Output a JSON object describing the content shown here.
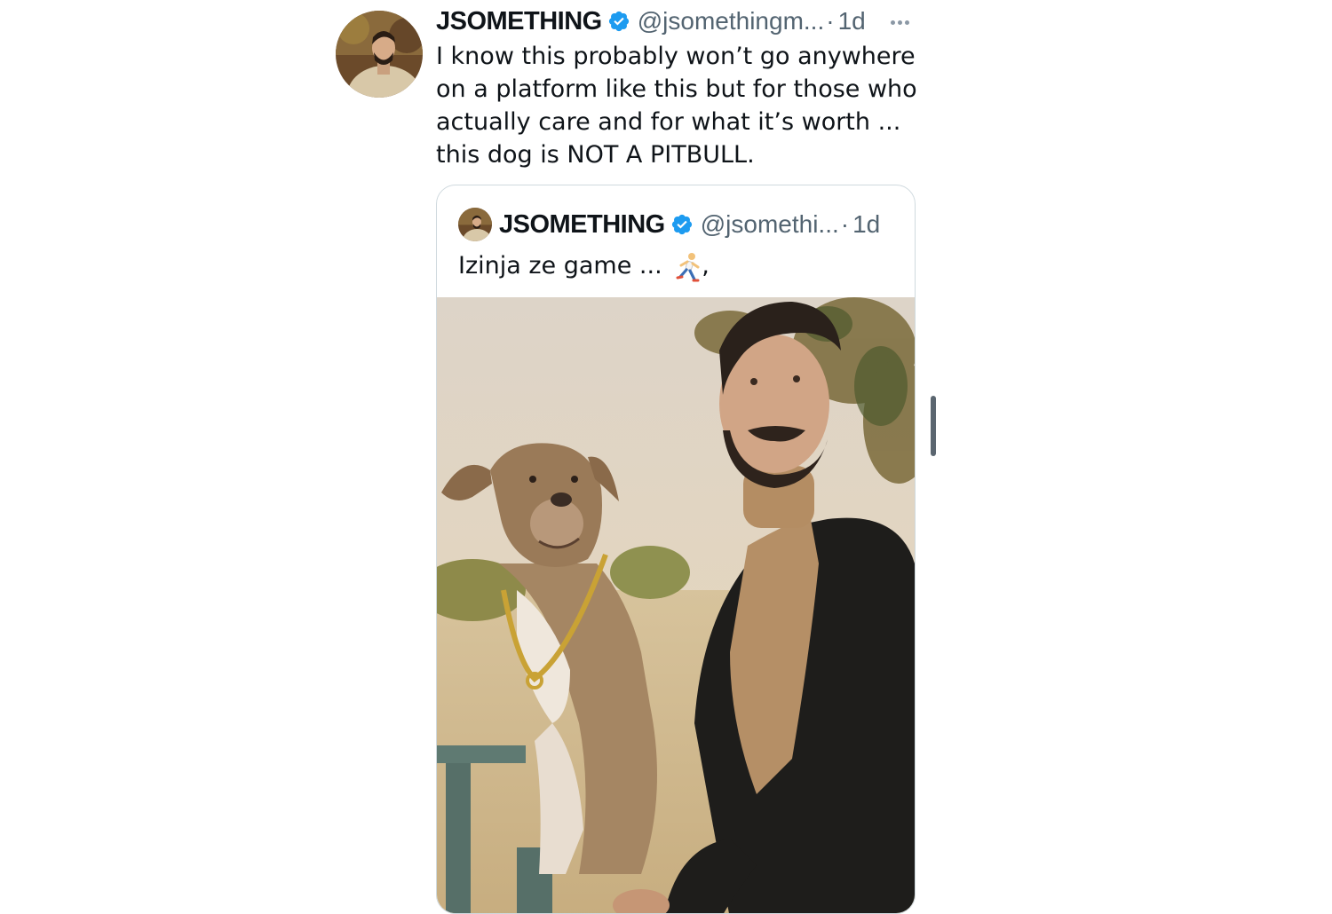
{
  "tweet": {
    "display_name": "JSOMETHING",
    "handle": "@jsomethingm...",
    "separator": "·",
    "time": "1d",
    "text_lines": [
      "I know this probably won’t go anywhere",
      "on a platform like this but for those who",
      "actually care and for what it’s worth ...",
      "this dog is NOT A PITBULL."
    ]
  },
  "quoted_tweet": {
    "display_name": "JSOMETHING",
    "handle": "@jsomethi...",
    "separator": "·",
    "time": "1d",
    "text": "Izinja ze game ...",
    "trailing": ",",
    "emoji_icon": "person-running-icon",
    "media": "photo-man-with-dog-on-bench"
  },
  "colors": {
    "verified_badge": "#1d9bf0",
    "secondary_text": "#536471",
    "border": "#cfd9de"
  },
  "icons": {
    "verified": "verified-badge-icon",
    "more": "more-options-icon"
  }
}
